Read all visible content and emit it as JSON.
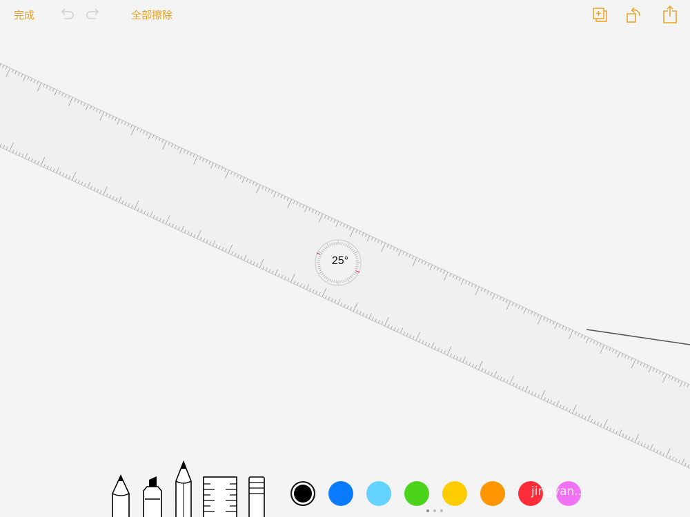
{
  "toolbar": {
    "done_label": "完成",
    "clear_all_label": "全部擦除",
    "icons": [
      "undo-icon",
      "redo-icon",
      "add-page-icon",
      "rotate-icon",
      "share-icon"
    ]
  },
  "ruler": {
    "angle_label": "25°",
    "angle_degrees": 25
  },
  "tools": [
    "pen",
    "marker",
    "pencil",
    "ruler",
    "eraser"
  ],
  "colors": {
    "accent": "#e9a11c",
    "palette": [
      "#000000",
      "#0a7aff",
      "#64d2ff",
      "#4cd41c",
      "#ffcc00",
      "#ff9500",
      "#ff2d3a",
      "#f172f5"
    ],
    "selected_index": 0
  },
  "page_indicator": {
    "count": 3,
    "active": 0
  },
  "watermark": "jingyan..."
}
